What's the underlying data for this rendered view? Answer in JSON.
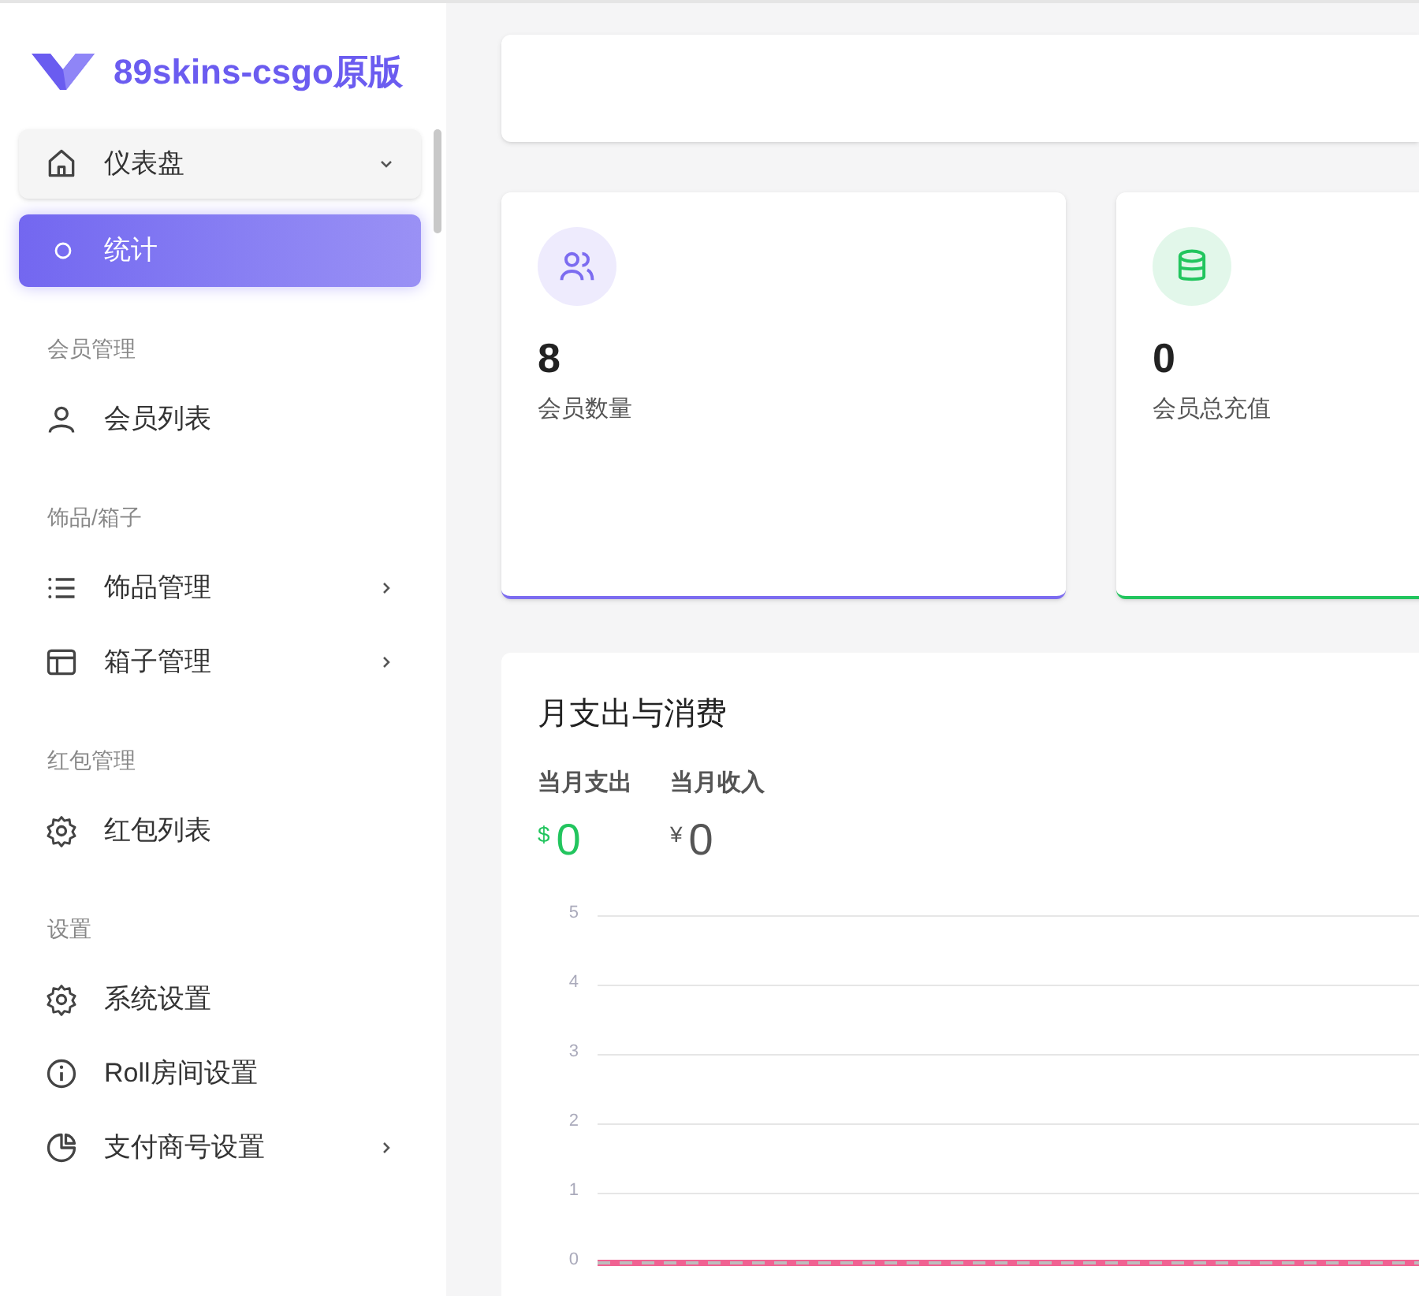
{
  "brand": {
    "title": "89skins-csgo原版"
  },
  "sidebar": {
    "items": [
      {
        "kind": "group",
        "label": "仪表盘",
        "expanded": true,
        "children": [
          {
            "label": "统计",
            "selected": true
          }
        ]
      },
      {
        "kind": "section",
        "label": "会员管理"
      },
      {
        "kind": "item",
        "label": "会员列表",
        "has_submenu": false
      },
      {
        "kind": "section",
        "label": "饰品/箱子"
      },
      {
        "kind": "item",
        "label": "饰品管理",
        "has_submenu": true
      },
      {
        "kind": "item",
        "label": "箱子管理",
        "has_submenu": true
      },
      {
        "kind": "section",
        "label": "红包管理"
      },
      {
        "kind": "item",
        "label": "红包列表",
        "has_submenu": false
      },
      {
        "kind": "section",
        "label": "设置"
      },
      {
        "kind": "item",
        "label": "系统设置",
        "has_submenu": false
      },
      {
        "kind": "item",
        "label": "Roll房间设置",
        "has_submenu": false
      },
      {
        "kind": "item",
        "label": "支付商号设置",
        "has_submenu": true
      }
    ]
  },
  "stats": [
    {
      "value": "8",
      "label": "会员数量",
      "color": "#7c6cf0"
    },
    {
      "value": "0",
      "label": "会员总充值",
      "color": "#22c55e"
    }
  ],
  "finance": {
    "title": "月支出与消费",
    "summary": [
      {
        "label": "当月支出",
        "currency": "$",
        "amount": "0",
        "color": "#22c55e"
      },
      {
        "label": "当月收入",
        "currency": "¥",
        "amount": "0",
        "color": "#555555"
      }
    ],
    "chart_data": {
      "type": "line",
      "grid": true,
      "ylim": [
        0,
        5
      ],
      "yticks": [
        0,
        1,
        2,
        3,
        4,
        5
      ],
      "series": [
        {
          "color": "#f06292",
          "line_style": "solid",
          "values": [
            0,
            0,
            0,
            0,
            0,
            0,
            0,
            0,
            0,
            0,
            0,
            0
          ]
        },
        {
          "color": "#bdbdbd",
          "line_style": "dashed",
          "values": [
            0,
            0,
            0,
            0,
            0,
            0,
            0,
            0,
            0,
            0,
            0,
            0
          ]
        }
      ]
    }
  }
}
